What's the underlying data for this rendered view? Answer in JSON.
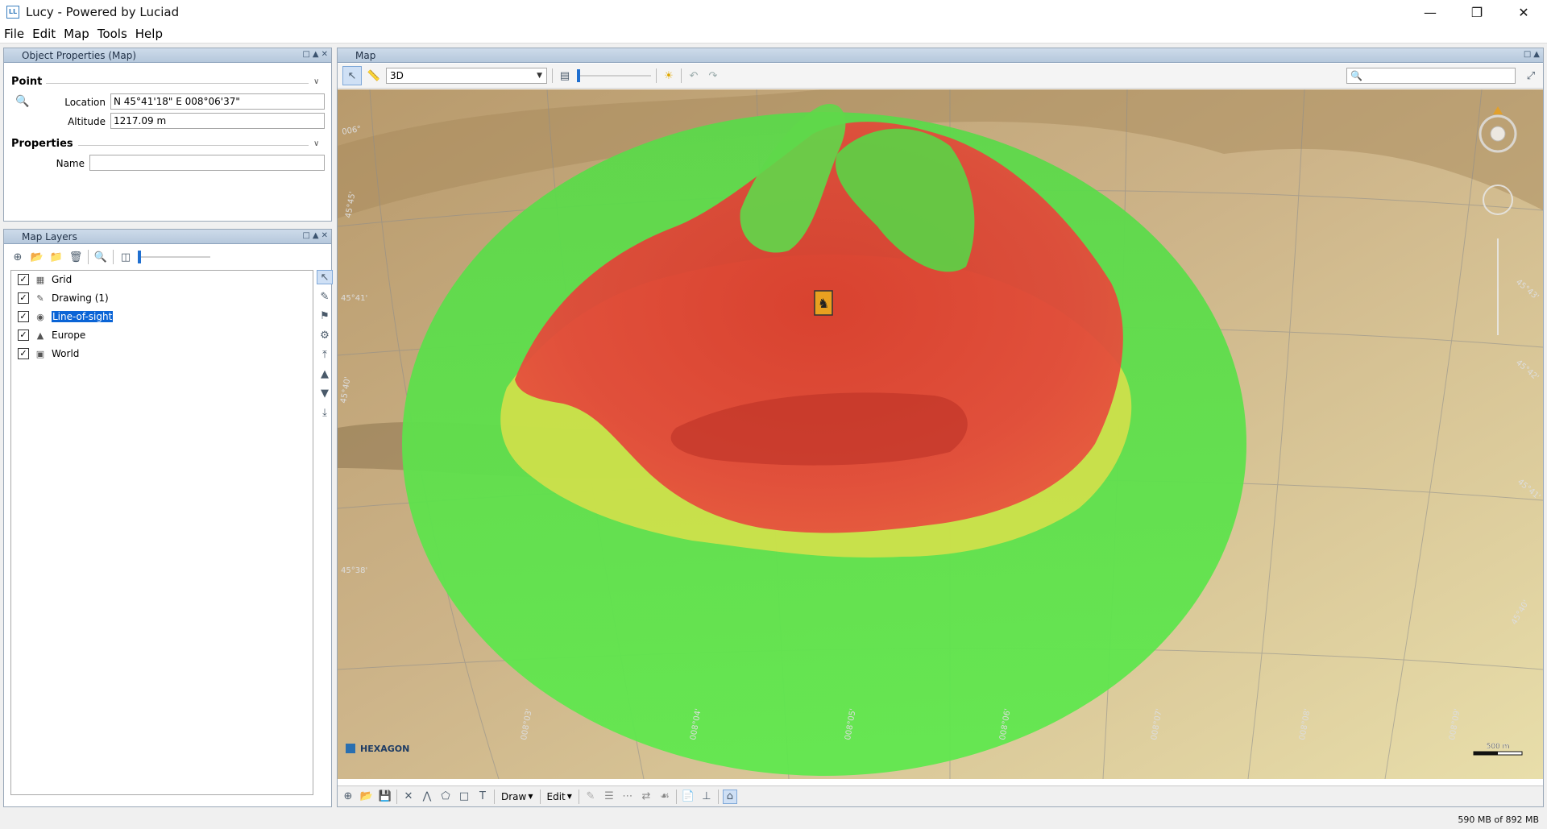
{
  "window": {
    "title": "Lucy - Powered by Luciad",
    "app_icon_text": "LL"
  },
  "menu": [
    "File",
    "Edit",
    "Map",
    "Tools",
    "Help"
  ],
  "object_properties": {
    "title": "Object Properties (Map)",
    "point_section": "Point",
    "location_label": "Location",
    "location_value": "N 45°41'18\" E 008°06'37\"",
    "altitude_label": "Altitude",
    "altitude_value": "1217.09 m",
    "properties_section": "Properties",
    "name_label": "Name",
    "name_value": ""
  },
  "map_layers": {
    "title": "Map Layers",
    "opacity_fraction": 0,
    "layers": [
      {
        "label": "Grid",
        "checked": true,
        "icon": "grid-icon",
        "selected": false
      },
      {
        "label": "Drawing (1)",
        "checked": true,
        "icon": "pencil-icon",
        "selected": false
      },
      {
        "label": "Line-of-sight",
        "checked": true,
        "icon": "eye-icon",
        "selected": true
      },
      {
        "label": "Europe",
        "checked": true,
        "icon": "terrain-icon",
        "selected": false
      },
      {
        "label": "World",
        "checked": true,
        "icon": "image-icon",
        "selected": false
      }
    ]
  },
  "map": {
    "title": "Map",
    "mode": "3D",
    "search_value": "",
    "brand": "HEXAGON",
    "scale_label": "500 m",
    "grid_labels": {
      "lon_top": "006°",
      "lat_left_1": "45°45'",
      "lat_left_2": "45°41'",
      "lat_left_3": "45°40'",
      "lat_bottom_left": "45°38'",
      "bottom_1": "008°03'",
      "bottom_2": "008°04'",
      "bottom_3": "008°05'",
      "bottom_4": "008°06'",
      "bottom_5": "008°07'",
      "bottom_6": "008°08'",
      "bottom_7": "008°09'",
      "right_1": "45°43'",
      "right_2": "45°42'",
      "right_3": "45°41'",
      "right_4": "45°40'"
    },
    "bottom_toolbar": {
      "draw_label": "Draw",
      "edit_label": "Edit"
    }
  },
  "status": {
    "memory": "590 MB of 892 MB"
  },
  "colors": {
    "panel_header": "#b6c8dc",
    "selection": "#0a64d6",
    "visible": "#4ee04e",
    "not_visible": "#e8453a",
    "terrain": "#c2a878"
  }
}
